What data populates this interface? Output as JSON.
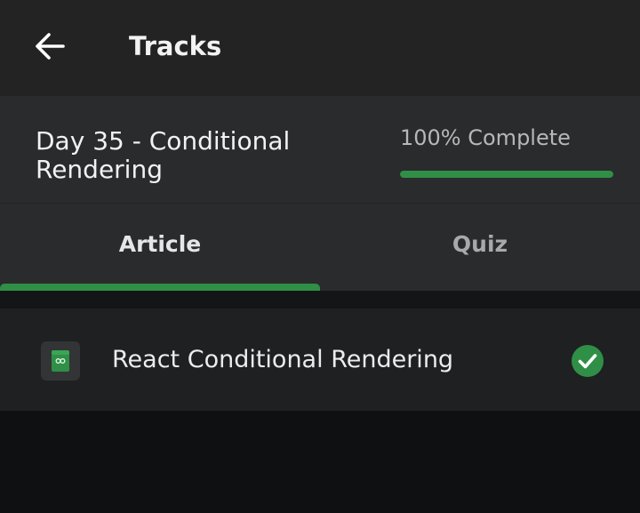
{
  "header": {
    "back_icon": "arrow-left-icon",
    "title": "Tracks"
  },
  "lesson": {
    "title": "Day 35 - Conditional Rendering",
    "progress_text": "100% Complete",
    "progress_percent": 100
  },
  "tabs": [
    {
      "label": "Article",
      "active": true
    },
    {
      "label": "Quiz",
      "active": false
    }
  ],
  "items": [
    {
      "icon": "article-book-icon",
      "label": "React Conditional Rendering",
      "status_icon": "check-circle-icon",
      "completed": true
    }
  ],
  "colors": {
    "accent_green": "#2f8f46",
    "header_bg": "#232323",
    "panel_bg": "#2a2b2d",
    "item_bg": "#1e2022"
  }
}
